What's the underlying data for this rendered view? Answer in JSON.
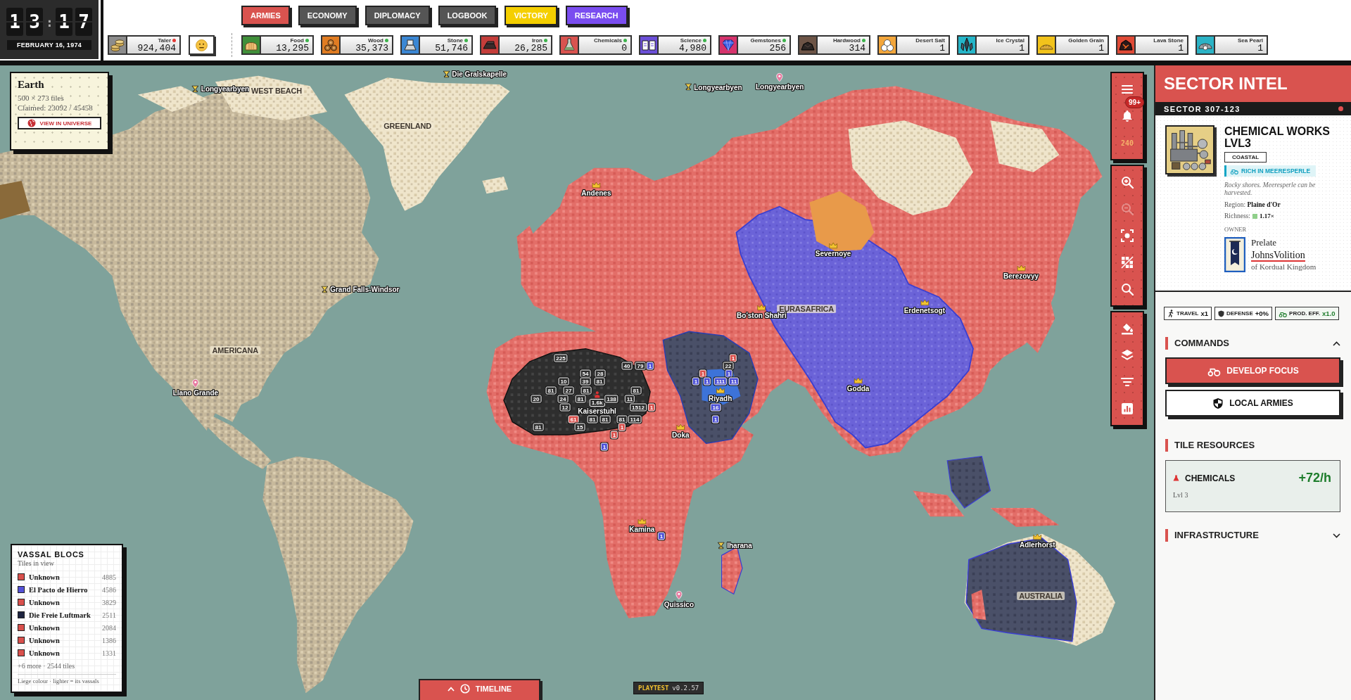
{
  "clock": {
    "hour_digits": [
      "1",
      "3"
    ],
    "separator": ":",
    "minute_digits": [
      "1",
      "7"
    ],
    "date": "FEBRUARY 16, 1974"
  },
  "tabs": [
    {
      "label": "ARMIES",
      "color": "#d9534f"
    },
    {
      "label": "ECONOMY",
      "color": "#555555"
    },
    {
      "label": "DIPLOMACY",
      "color": "#555555"
    },
    {
      "label": "LOGBOOK",
      "color": "#555555"
    },
    {
      "label": "VICTORY",
      "color": "#f5cf00"
    },
    {
      "label": "RESEARCH",
      "color": "#7a4df0"
    }
  ],
  "treasury": {
    "kind": "coins",
    "label": "Taler",
    "value": "924,404",
    "color": "#8c8c8c",
    "status_dot": {
      "color": "#e53935"
    }
  },
  "mood": {
    "kind": "neutral"
  },
  "resources": [
    {
      "kind": "food",
      "label": "Food",
      "value": "13,295",
      "color": "#3f8f3a",
      "status_dot": {
        "color": "#3cb44b"
      }
    },
    {
      "kind": "wood",
      "label": "Wood",
      "value": "35,373",
      "color": "#e07c22",
      "status_dot": {
        "color": "#3cb44b"
      }
    },
    {
      "kind": "stone",
      "label": "Stone",
      "value": "51,746",
      "color": "#3b87d4",
      "status_dot": {
        "color": "#3cb44b"
      }
    },
    {
      "kind": "iron",
      "label": "Iron",
      "value": "26,285",
      "color": "#c43d3a",
      "status_dot": {
        "color": "#3cb44b"
      }
    },
    {
      "kind": "chemicals",
      "label": "Chemicals",
      "value": "0",
      "color": "#d9534f",
      "status_dot": {
        "color": "#3cb44b"
      }
    },
    {
      "kind": "science",
      "label": "Science",
      "value": "4,980",
      "color": "#6b4fd8",
      "status_dot": {
        "color": "#3cb44b"
      }
    },
    {
      "kind": "gemstones",
      "label": "Gemstones",
      "value": "256",
      "color": "#d6336c",
      "status_dot": {
        "color": "#3cb44b"
      }
    },
    {
      "kind": "hardwood",
      "label": "Hardwood",
      "value": "314",
      "color": "#6d5446",
      "status_dot": {
        "color": "#3cb44b"
      }
    },
    {
      "kind": "salt",
      "label": "Desert Salt",
      "value": "1",
      "color": "#f3a63b"
    },
    {
      "kind": "crystal",
      "label": "Ice Crystal",
      "value": "1",
      "color": "#25b5c8"
    },
    {
      "kind": "grain",
      "label": "Golden Grain",
      "value": "1",
      "color": "#f2c31b"
    },
    {
      "kind": "lava",
      "label": "Lava Stone",
      "value": "1",
      "color": "#e04a36"
    },
    {
      "kind": "pearl",
      "label": "Sea Pearl",
      "value": "1",
      "color": "#2bb3c6"
    }
  ],
  "world": {
    "name": "Earth",
    "size": "500 × 273 tiles",
    "claimed": "Claimed: 23092 / 45458",
    "button": "VIEW IN UNIVERSE"
  },
  "places": [
    {
      "name": "Longyearbyen",
      "kind": "chalice"
    },
    {
      "name": "WEST BEACH",
      "kind": "region"
    },
    {
      "name": "Die Gralskapelle",
      "kind": "chalice"
    },
    {
      "name": "Longyearbyen",
      "kind": "chalice"
    },
    {
      "name": "Longyearbyen",
      "kind": "pin"
    },
    {
      "name": "GREENLAND",
      "kind": "region"
    },
    {
      "name": "Andenes",
      "kind": "crown"
    },
    {
      "name": "Severnoye",
      "kind": "crown"
    },
    {
      "name": "Berezovyy",
      "kind": "crown"
    },
    {
      "name": "Grand Falls-Windsor",
      "kind": "chalice"
    },
    {
      "name": "EURASAFRICA",
      "kind": "region"
    },
    {
      "name": "Bo'ston Shahri",
      "kind": "crown"
    },
    {
      "name": "Erdenetsogt",
      "kind": "crown"
    },
    {
      "name": "AMERICANA",
      "kind": "region"
    },
    {
      "name": "Riyadh",
      "kind": "crown"
    },
    {
      "name": "Godda",
      "kind": "crown"
    },
    {
      "name": "Llano Grande",
      "kind": "pin"
    },
    {
      "name": "Kaiserstuhl",
      "kind": "army",
      "army": "1.6k"
    },
    {
      "name": "Doka",
      "kind": "crown"
    },
    {
      "name": "Kamina",
      "kind": "crown"
    },
    {
      "name": "Iharana",
      "kind": "chalice"
    },
    {
      "name": "Adlerhorst",
      "kind": "crown"
    },
    {
      "name": "AUSTRALIA",
      "kind": "region"
    },
    {
      "name": "Quissico",
      "kind": "pin"
    }
  ],
  "units": [
    {
      "count": "225",
      "color": "#2b2b2b"
    },
    {
      "count": "1",
      "color": "#d9504c"
    },
    {
      "count": "40",
      "color": "#2b2b2b"
    },
    {
      "count": "79",
      "color": "#2b2b2b"
    },
    {
      "count": "1",
      "color": "#4b4fd6"
    },
    {
      "count": "22",
      "color": "#2b2b2b"
    },
    {
      "count": "54",
      "color": "#2b2b2b"
    },
    {
      "count": "28",
      "color": "#2b2b2b"
    },
    {
      "count": "1",
      "color": "#d9504c"
    },
    {
      "count": "1",
      "color": "#4b4fd6"
    },
    {
      "count": "10",
      "color": "#2b2b2b"
    },
    {
      "count": "39",
      "color": "#2b2b2b"
    },
    {
      "count": "81",
      "color": "#2b2b2b"
    },
    {
      "count": "1",
      "color": "#4b4fd6"
    },
    {
      "count": "1",
      "color": "#4b4fd6"
    },
    {
      "count": "111",
      "color": "#4b4fd6"
    },
    {
      "count": "11",
      "color": "#4b4fd6"
    },
    {
      "count": "81",
      "color": "#2b2b2b"
    },
    {
      "count": "27",
      "color": "#2b2b2b"
    },
    {
      "count": "81",
      "color": "#2b2b2b"
    },
    {
      "count": "81",
      "color": "#2b2b2b"
    },
    {
      "count": "20",
      "color": "#2b2b2b"
    },
    {
      "count": "24",
      "color": "#2b2b2b"
    },
    {
      "count": "81",
      "color": "#2b2b2b"
    },
    {
      "count": "138",
      "color": "#2b2b2b"
    },
    {
      "count": "11",
      "color": "#2b2b2b"
    },
    {
      "count": "12",
      "color": "#2b2b2b"
    },
    {
      "count": "1512",
      "color": "#2b2b2b"
    },
    {
      "count": "1",
      "color": "#d9504c"
    },
    {
      "count": "16",
      "color": "#4b4fd6"
    },
    {
      "count": "61",
      "color": "#d9504c"
    },
    {
      "count": "81",
      "color": "#2b2b2b"
    },
    {
      "count": "81",
      "color": "#2b2b2b"
    },
    {
      "count": "81",
      "color": "#2b2b2b"
    },
    {
      "count": "114",
      "color": "#2b2b2b"
    },
    {
      "count": "1",
      "color": "#4b4fd6"
    },
    {
      "count": "81",
      "color": "#2b2b2b"
    },
    {
      "count": "15",
      "color": "#2b2b2b"
    },
    {
      "count": "1",
      "color": "#d9504c"
    },
    {
      "count": "1",
      "color": "#d9504c"
    },
    {
      "count": "1",
      "color": "#4b4fd6"
    },
    {
      "count": "1",
      "color": "#4b4fd6"
    }
  ],
  "map_toolbar": [
    {
      "items": [
        {
          "kind": "menu",
          "disabled": false
        },
        {
          "kind": "bell",
          "badge": "99+",
          "disabled": false
        },
        {
          "kind": "counter",
          "text": "240",
          "disabled": false
        }
      ]
    },
    {
      "items": [
        {
          "kind": "zoom-in",
          "disabled": false
        },
        {
          "kind": "zoom-out",
          "disabled": true
        },
        {
          "kind": "focus",
          "disabled": false
        },
        {
          "kind": "grid",
          "disabled": false
        },
        {
          "kind": "search",
          "disabled": false
        }
      ]
    },
    {
      "items": [
        {
          "kind": "paint",
          "disabled": false
        },
        {
          "kind": "layers",
          "disabled": false
        },
        {
          "kind": "filter",
          "disabled": false
        },
        {
          "kind": "stats",
          "disabled": false
        }
      ]
    }
  ],
  "vassal_blocs": {
    "title": "VASSAL BLOCS",
    "subtitle": "Tiles in view",
    "rows": [
      {
        "name": "Unknown",
        "count": "4885",
        "color": "#d9504c"
      },
      {
        "name": "El Pacto de Hierro",
        "count": "4586",
        "color": "#5451d8"
      },
      {
        "name": "Unknown",
        "count": "3829",
        "color": "#d9504c"
      },
      {
        "name": "Die Freie Luftmark",
        "count": "2511",
        "color": "#1d2440"
      },
      {
        "name": "Unknown",
        "count": "2084",
        "color": "#d9504c"
      },
      {
        "name": "Unknown",
        "count": "1386",
        "color": "#d9504c"
      },
      {
        "name": "Unknown",
        "count": "1331",
        "color": "#d9504c"
      }
    ],
    "more": "+6 more · 2544 tiles",
    "note": "Liege colour · lighter = its vassals"
  },
  "timeline": {
    "label": "TIMELINE"
  },
  "build": {
    "tag": "PLAYTEST",
    "version": "v0.2.57"
  },
  "sector_intel": {
    "title": "SECTOR INTEL",
    "sector": "SECTOR 307-123",
    "tile": {
      "name": "CHEMICAL WORKS LVL3",
      "terrain": "COASTAL",
      "bonus": "RICH IN MEERESPERLE",
      "description": "Rocky shores. Meeresperle can be harvested.",
      "region": "Region: **Plaine d'Or**",
      "richness_label": "Richness:",
      "richness": "1.17×",
      "owner_label": "OWNER",
      "owner_title": "Prelate",
      "owner_name": "JohnsVolition",
      "owner_realm": "of Kordual Kingdom"
    },
    "stats": [
      {
        "kind": "travel",
        "label": "TRAVEL",
        "value": "x1"
      },
      {
        "kind": "defense",
        "label": "DEFENSE",
        "value": "+0%"
      },
      {
        "kind": "production",
        "label": "PROD. EFF.",
        "value": "x1.0"
      }
    ],
    "commands": {
      "title": "COMMANDS",
      "expanded": true,
      "buttons": [
        {
          "kind": "primary",
          "label": "DEVELOP FOCUS"
        },
        {
          "kind": "secondary",
          "label": "LOCAL ARMIES"
        }
      ]
    },
    "tile_resources": {
      "title": "TILE RESOURCES",
      "items": [
        {
          "name": "CHEMICALS",
          "rate": "+72/h",
          "tier": "Lvl 3"
        }
      ]
    },
    "infrastructure": {
      "title": "INFRASTRUCTURE",
      "expanded": false
    }
  }
}
